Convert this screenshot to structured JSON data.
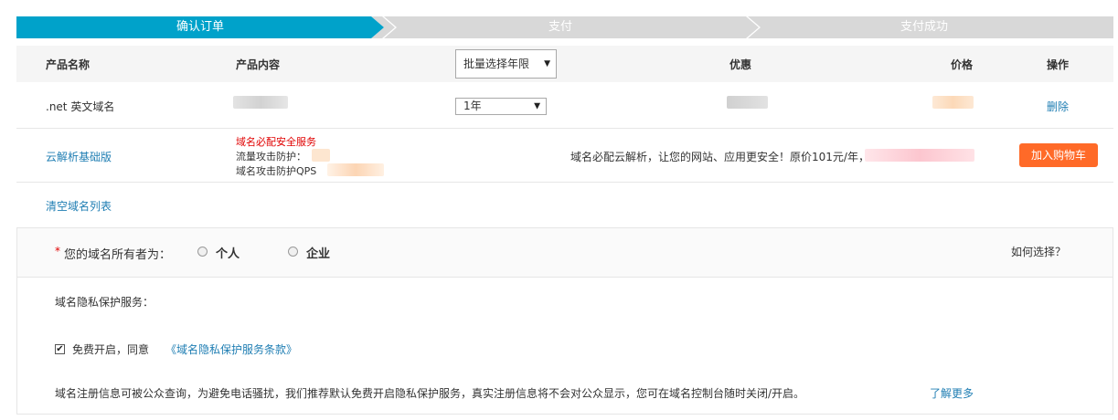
{
  "steps": [
    "确认订单",
    "支付",
    "支付成功"
  ],
  "table": {
    "headers": {
      "name": "产品名称",
      "content": "产品内容",
      "discount": "优惠",
      "price": "价格",
      "action": "操作"
    },
    "batch_select_label": "批量选择年限",
    "rows": [
      {
        "name": ".net 英文域名",
        "year": "1年",
        "action": "删除"
      },
      {
        "name": "云解析基础版",
        "content_lines": [
          "域名必配安全服务",
          "流量攻击防护：",
          "域名攻击防护QPS"
        ],
        "promo": "域名必配云解析，让您的网站、应用更安全！原价101元/年，",
        "action": "加入购物车"
      }
    ]
  },
  "clear_list": "清空域名列表",
  "owner": {
    "asterisk": "*",
    "label": "您的域名所有者为：",
    "options": [
      "个人",
      "企业"
    ],
    "help": "如何选择？"
  },
  "privacy": {
    "title": "域名隐私保护服务：",
    "checkbox_text": "免费开启，同意",
    "terms_link": "《域名隐私保护服务条款》",
    "notice": "域名注册信息可被公众查询，为避免电话骚扰，我们推荐默认免费开启隐私保护服务，真实注册信息将不会对公众显示，您可在域名控制台随时关闭/开启。",
    "learn_more": "了解更多"
  },
  "colors": {
    "accent": "#00a2ca",
    "step_inactive": "#d8d8d8",
    "link": "#1f7eb3",
    "button": "#ff6a28",
    "warning": "#e00000"
  }
}
